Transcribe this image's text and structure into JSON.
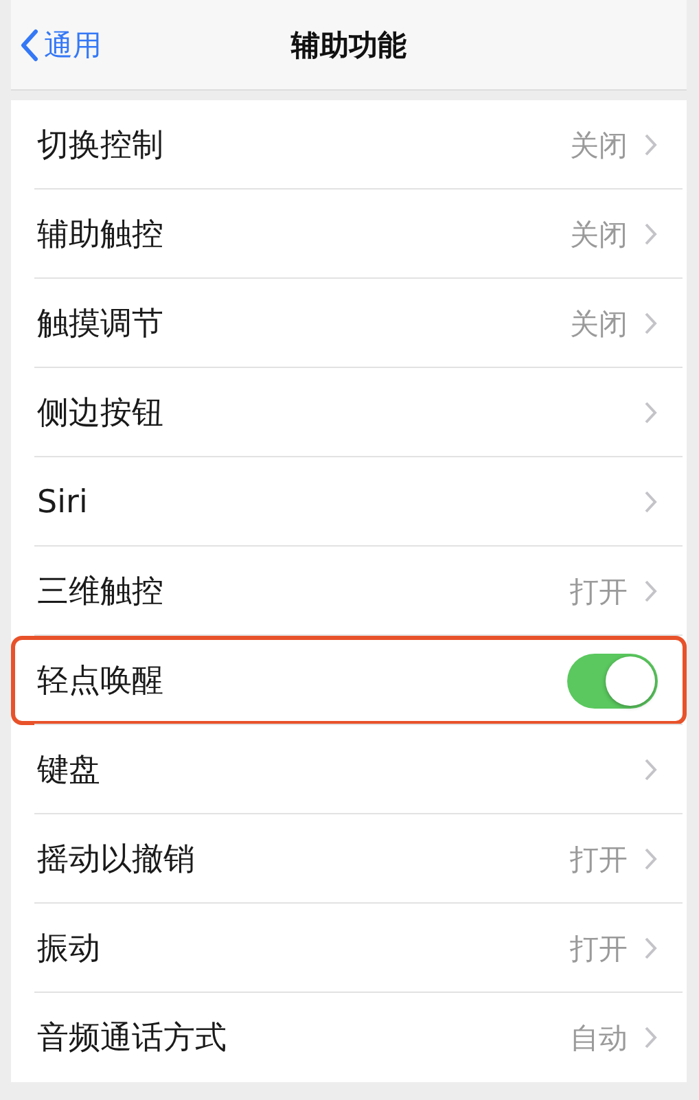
{
  "nav": {
    "back": "通用",
    "title": "辅助功能"
  },
  "rows": [
    {
      "kind": "detail",
      "label": "切换控制",
      "value": "关闭",
      "highlighted": false
    },
    {
      "kind": "detail",
      "label": "辅助触控",
      "value": "关闭",
      "highlighted": false
    },
    {
      "kind": "detail",
      "label": "触摸调节",
      "value": "关闭",
      "highlighted": false
    },
    {
      "kind": "detail",
      "label": "侧边按钮",
      "highlighted": false
    },
    {
      "kind": "detail",
      "label": "Siri",
      "highlighted": false
    },
    {
      "kind": "detail",
      "label": "三维触控",
      "value": "打开",
      "highlighted": false
    },
    {
      "kind": "toggle",
      "label": "轻点唤醒",
      "on": true,
      "highlighted": true
    },
    {
      "kind": "detail",
      "label": "键盘",
      "highlighted": false
    },
    {
      "kind": "detail",
      "label": "摇动以撤销",
      "value": "打开",
      "highlighted": false
    },
    {
      "kind": "detail",
      "label": "振动",
      "value": "打开",
      "highlighted": false
    },
    {
      "kind": "detail",
      "label": "音频通话方式",
      "value": "自动",
      "highlighted": false
    }
  ]
}
